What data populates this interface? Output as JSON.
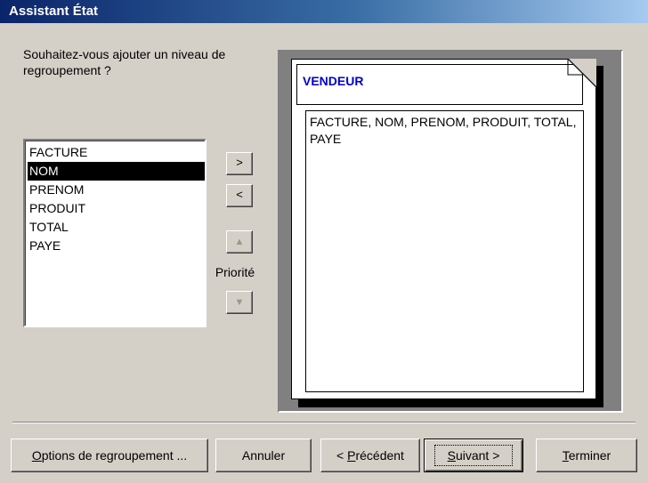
{
  "window": {
    "title": "Assistant État"
  },
  "question": "Souhaitez-vous ajouter un niveau de regroupement ?",
  "field_list": {
    "items": [
      "FACTURE",
      "NOM",
      "PRENOM",
      "PRODUIT",
      "TOTAL",
      "PAYE"
    ],
    "selected": "NOM"
  },
  "buttons": {
    "add": ">",
    "remove": "<",
    "priority_label": "Priorité",
    "options_pre": "",
    "options_ul": "O",
    "options_post": "ptions de regroupement ...",
    "cancel": "Annuler",
    "prev_pre": "< ",
    "prev_ul": "P",
    "prev_post": "récédent",
    "next_ul": "S",
    "next_post": "uivant >",
    "finish_ul": "T",
    "finish_post": "erminer"
  },
  "preview": {
    "group_header": "VENDEUR",
    "detail_fields": "FACTURE, NOM, PRENOM, PRODUIT, TOTAL, PAYE"
  }
}
